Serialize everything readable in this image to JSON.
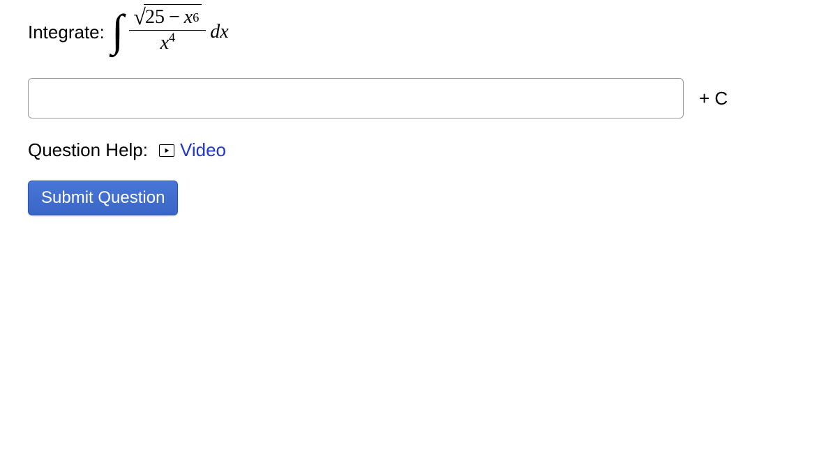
{
  "question": {
    "prompt": "Integrate:",
    "integral": {
      "numerator_inside_sqrt": {
        "a": "25",
        "var": "x",
        "exp": "6"
      },
      "denominator": {
        "var": "x",
        "exp": "4"
      },
      "dx": "dx"
    }
  },
  "answer": {
    "value": "",
    "constant": "+ C"
  },
  "help": {
    "label": "Question Help:",
    "video_label": "Video"
  },
  "submit_label": "Submit Question"
}
